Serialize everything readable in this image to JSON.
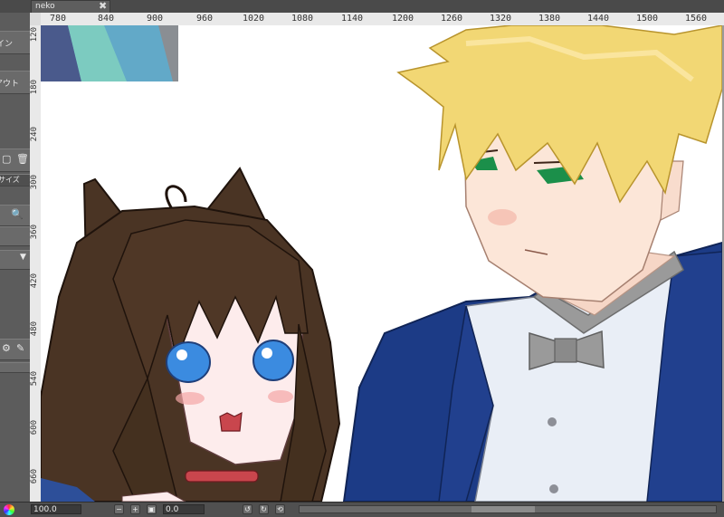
{
  "tab": {
    "label": "neko",
    "close": "✖"
  },
  "left_panel": {
    "items": [
      {
        "label": "イン"
      },
      {
        "label": "アウト"
      },
      {
        "label": "サイズ"
      }
    ]
  },
  "ruler_top": {
    "labels": [
      "780",
      "840",
      "900",
      "960",
      "1020",
      "1080",
      "1140",
      "1200",
      "1260",
      "1320",
      "1380",
      "1440",
      "1500",
      "1560"
    ]
  },
  "ruler_left": {
    "labels": [
      "120",
      "180",
      "240",
      "300",
      "360",
      "420",
      "480",
      "540",
      "600",
      "660"
    ]
  },
  "statusbar": {
    "zoom": "100.0",
    "angle": "0.0"
  },
  "colors": {
    "canvas": "#ffffff",
    "jacket": "#1c3b86",
    "hair_blond": "#f2d774",
    "hair_brown": "#4a3424",
    "eyes_blue": "#3b8be0"
  }
}
